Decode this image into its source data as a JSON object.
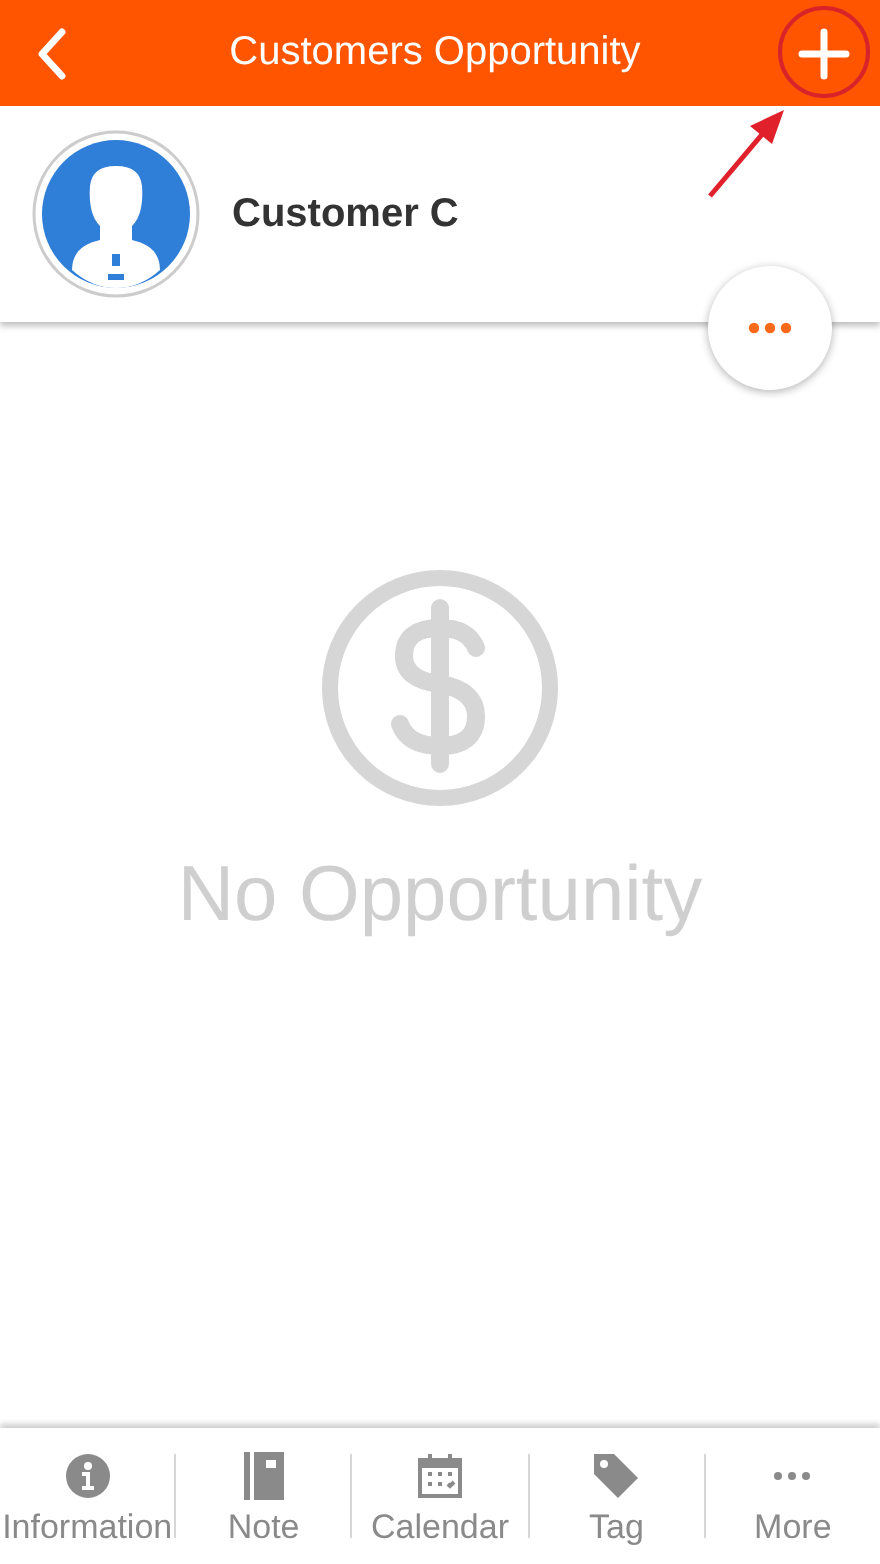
{
  "header": {
    "title": "Customers Opportunity"
  },
  "customer": {
    "name": "Customer C"
  },
  "empty_state": {
    "message": "No Opportunity"
  },
  "bottom_tabs": [
    {
      "label": "Information",
      "kind": "info"
    },
    {
      "label": "Note",
      "kind": "note"
    },
    {
      "label": "Calendar",
      "kind": "calendar"
    },
    {
      "label": "Tag",
      "kind": "tag"
    },
    {
      "label": "More",
      "kind": "more"
    }
  ]
}
